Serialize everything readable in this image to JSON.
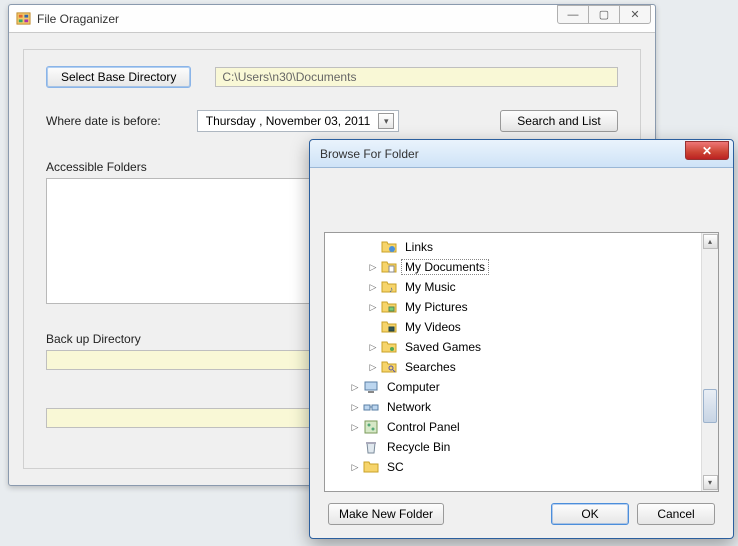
{
  "main_window": {
    "title": "File Oraganizer",
    "select_base_dir_label": "Select Base Directory",
    "base_dir_value": "C:\\Users\\n30\\Documents",
    "date_label": "Where date is before:",
    "date_value": "Thursday  , November 03, 2011",
    "search_list_label": "Search and List",
    "accessible_folders_label": "Accessible Folders",
    "backup_dir_label": "Back up Directory"
  },
  "browse_dialog": {
    "title": "Browse For Folder",
    "make_new_folder_label": "Make New Folder",
    "ok_label": "OK",
    "cancel_label": "Cancel",
    "tree": [
      {
        "indent": 2,
        "expander": "",
        "icon": "folder-link",
        "label": "Links",
        "selected": false
      },
      {
        "indent": 2,
        "expander": "▷",
        "icon": "folder-docs",
        "label": "My Documents",
        "selected": true
      },
      {
        "indent": 2,
        "expander": "▷",
        "icon": "folder-music",
        "label": "My Music",
        "selected": false
      },
      {
        "indent": 2,
        "expander": "▷",
        "icon": "folder-pics",
        "label": "My Pictures",
        "selected": false
      },
      {
        "indent": 2,
        "expander": "",
        "icon": "folder-video",
        "label": "My Videos",
        "selected": false
      },
      {
        "indent": 2,
        "expander": "▷",
        "icon": "folder-games",
        "label": "Saved Games",
        "selected": false
      },
      {
        "indent": 2,
        "expander": "▷",
        "icon": "folder-search",
        "label": "Searches",
        "selected": false
      },
      {
        "indent": 1,
        "expander": "▷",
        "icon": "computer",
        "label": "Computer",
        "selected": false
      },
      {
        "indent": 1,
        "expander": "▷",
        "icon": "network",
        "label": "Network",
        "selected": false
      },
      {
        "indent": 1,
        "expander": "▷",
        "icon": "control",
        "label": "Control Panel",
        "selected": false
      },
      {
        "indent": 1,
        "expander": "",
        "icon": "recycle",
        "label": "Recycle Bin",
        "selected": false
      },
      {
        "indent": 1,
        "expander": "▷",
        "icon": "folder",
        "label": "SC",
        "selected": false
      }
    ]
  }
}
